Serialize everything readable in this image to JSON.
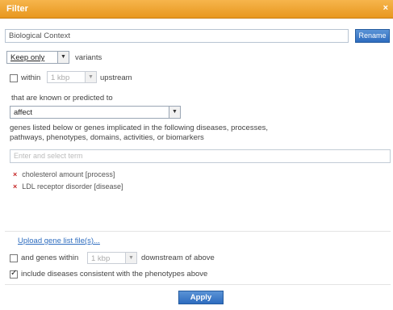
{
  "window": {
    "title": "Filter",
    "close_glyph": "×"
  },
  "context": {
    "name": "Biological Context",
    "rename_label": "Rename"
  },
  "mode": {
    "selected": "Keep only",
    "suffix": "variants"
  },
  "distance_upstream": {
    "within_label": "within",
    "value": "1 kbp",
    "suffix": "upstream"
  },
  "prompt_label": "that are known or predicted to",
  "effect": {
    "selected": "affect"
  },
  "description": "genes listed below or genes implicated in the following diseases, processes, pathways, phenotypes, domains, activities, or biomarkers",
  "search": {
    "placeholder": "Enter and select term"
  },
  "genes": [
    {
      "label": "cholesterol amount [process]"
    },
    {
      "label": "LDL receptor disorder [disease]"
    }
  ],
  "upload_link": "Upload gene list file(s)...",
  "downstream": {
    "label": "and genes within",
    "value": "1 kbp",
    "suffix": "downstream of above"
  },
  "include_option": {
    "label": "include diseases consistent with the phenotypes above",
    "checked": true
  },
  "apply_label": "Apply"
}
